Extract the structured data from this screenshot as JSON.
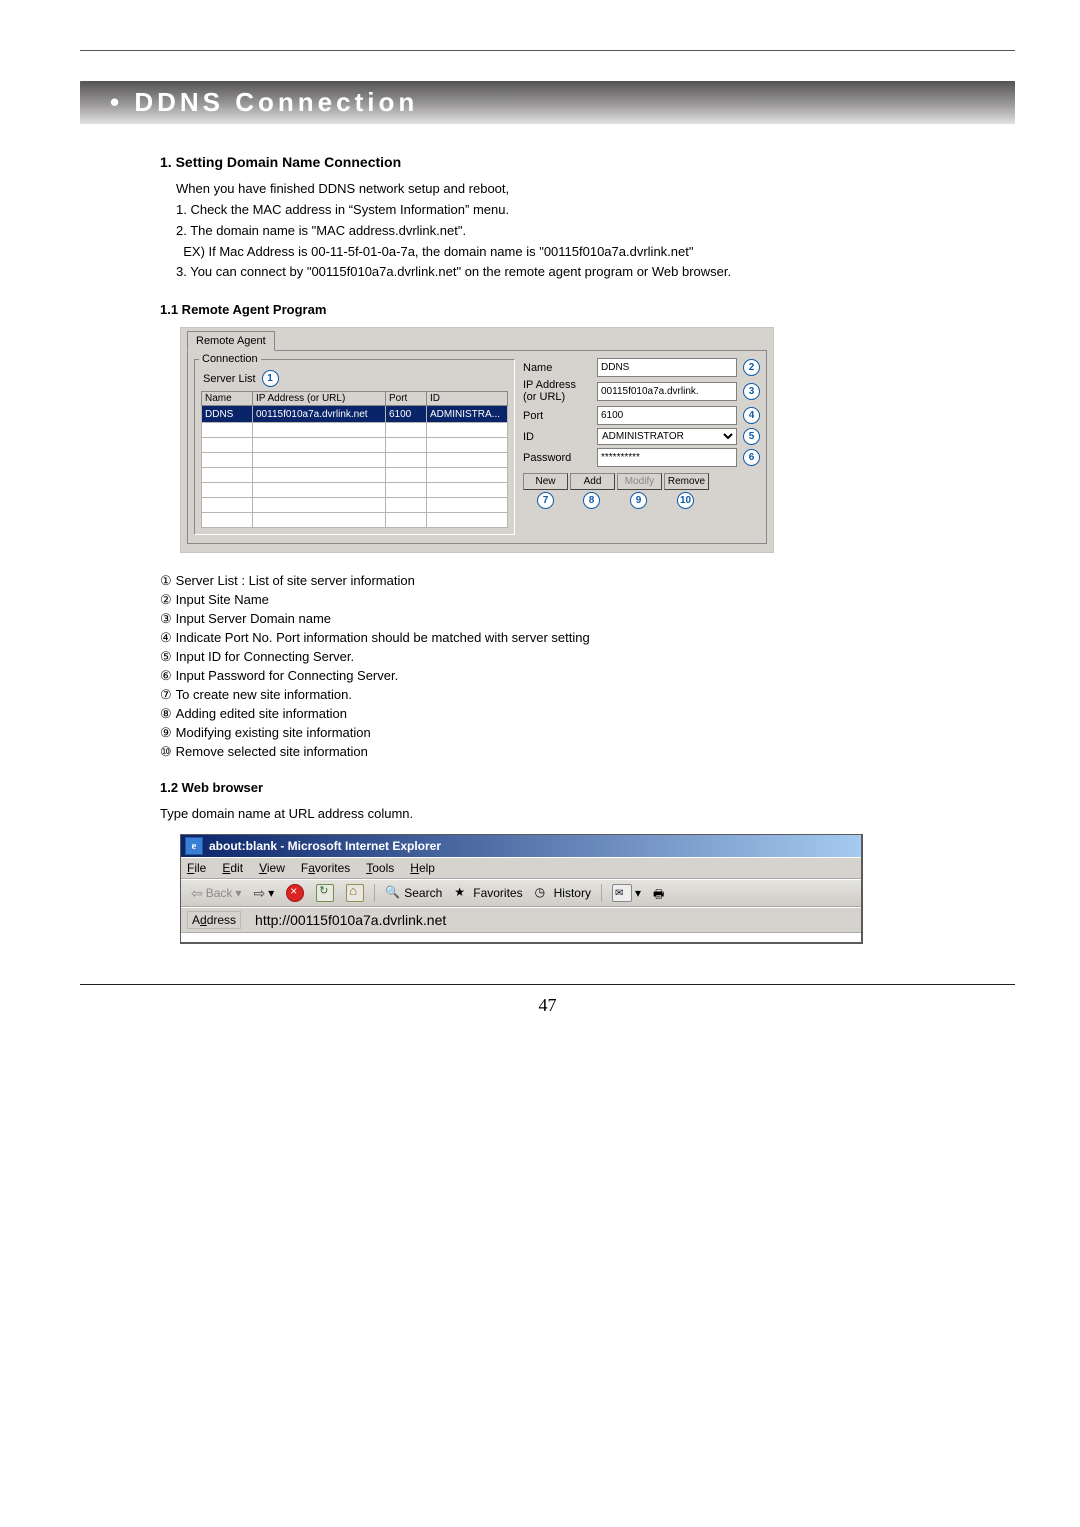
{
  "page": {
    "number": "47"
  },
  "title": {
    "bullet": "• ",
    "text": "DDNS Connection"
  },
  "sec1": {
    "heading": "1. Setting Domain Name Connection",
    "intro": "When you have finished DDNS network setup and reboot,",
    "line1": "1. Check the MAC address in “System Information” menu.",
    "line2": "2. The domain name is \"MAC address.dvrlink.net\".",
    "line2ex": "  EX) If Mac Address is 00-11-5f-01-0a-7a, the domain name is \"00115f010a7a.dvrlink.net\"",
    "line3": "3. You can connect by \"00115f010a7a.dvrlink.net\" on the remote agent program or Web browser."
  },
  "sec11": {
    "heading": "1.1 Remote Agent Program"
  },
  "remote_agent": {
    "tab": "Remote Agent",
    "group": "Connection",
    "server_list_label": "Server List",
    "cols": {
      "name": "Name",
      "ip": "IP Address (or URL)",
      "port": "Port",
      "id": "ID"
    },
    "rows": [
      {
        "name": "DDNS",
        "ip": "00115f010a7a.dvrlink.net",
        "port": "6100",
        "id": "ADMINISTRA..."
      }
    ],
    "form": {
      "name_label": "Name",
      "name_value": "DDNS",
      "ip_label": "IP Address (or URL)",
      "ip_value": "00115f010a7a.dvrlink.",
      "port_label": "Port",
      "port_value": "6100",
      "id_label": "ID",
      "id_value": "ADMINISTRATOR",
      "pw_label": "Password",
      "pw_value": "**********"
    },
    "buttons": {
      "new": "New",
      "add": "Add",
      "modify": "Modify",
      "remove": "Remove"
    },
    "callouts": {
      "c1": "1",
      "c2": "2",
      "c3": "3",
      "c4": "4",
      "c5": "5",
      "c6": "6",
      "c7": "7",
      "c8": "8",
      "c9": "9",
      "c10": "10"
    }
  },
  "annotations": {
    "a1": "Server List : List of site server information",
    "a2": "Input Site Name",
    "a3": "Input Server Domain name",
    "a4": "Indicate Port No. Port information should be matched with server setting",
    "a5": "Input ID for Connecting Server.",
    "a6": "Input Password for Connecting Server.",
    "a7": "To create  new site information.",
    "a8": "Adding edited site information",
    "a9": "Modifying existing site information",
    "a10": "Remove selected site information"
  },
  "circled_glyphs": {
    "g1": "①",
    "g2": "②",
    "g3": "③",
    "g4": "④",
    "g5": "⑤",
    "g6": "⑥",
    "g7": "⑦",
    "g8": "⑧",
    "g9": "⑨",
    "g10": "⑩"
  },
  "sec12": {
    "heading": "1.2 Web browser",
    "body": "Type domain name at URL address column."
  },
  "ie": {
    "title": "about:blank - Microsoft Internet Explorer",
    "menu": {
      "file": "File",
      "edit": "Edit",
      "view": "View",
      "fav": "Favorites",
      "tools": "Tools",
      "help": "Help"
    },
    "tool": {
      "back": "Back",
      "search": "Search",
      "favorites": "Favorites",
      "history": "History"
    },
    "addr_label": "Address",
    "url": "http://00115f010a7a.dvrlink.net"
  }
}
